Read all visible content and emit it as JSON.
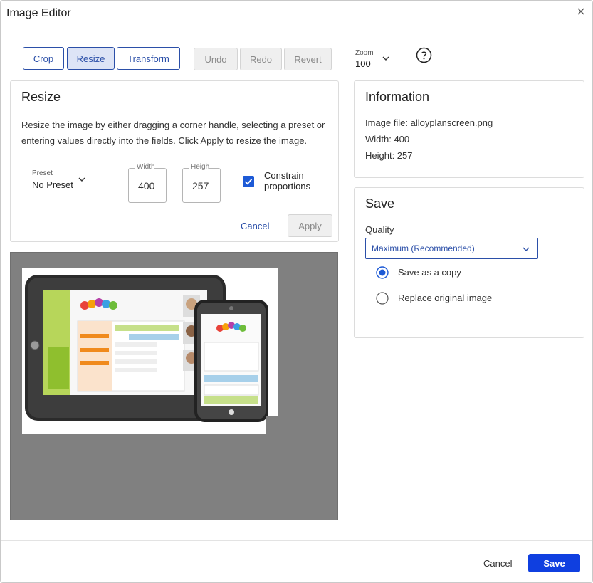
{
  "dialog": {
    "title": "Image Editor",
    "close_icon": "close-icon"
  },
  "toolbar": {
    "modes": [
      "Crop",
      "Resize",
      "Transform"
    ],
    "active_mode": "Resize",
    "history": [
      "Undo",
      "Redo",
      "Revert"
    ],
    "zoom_label": "Zoom",
    "zoom_value": "100",
    "help_icon": "help-circle-icon"
  },
  "resize": {
    "title": "Resize",
    "description": "Resize the image by either dragging a corner handle, selecting a preset or entering values directly into the fields. Click Apply to resize the image.",
    "preset_label": "Preset",
    "preset_value": "No Preset",
    "width_label": "Width",
    "width_value": "400",
    "height_label": "Height",
    "height_value": "257",
    "constrain_label_1": "Constrain",
    "constrain_label_2": "proportions",
    "constrain_checked": true,
    "cancel_label": "Cancel",
    "apply_label": "Apply"
  },
  "information": {
    "title": "Information",
    "file_line": "Image file: alloyplanscreen.png",
    "width_line": "Width: 400",
    "height_line": "Height: 257"
  },
  "save_panel": {
    "title": "Save",
    "quality_label": "Quality",
    "quality_value": "Maximum (Recommended)",
    "options": [
      "Save as a copy",
      "Replace original image"
    ],
    "selected_option": "Save as a copy"
  },
  "footer": {
    "cancel_label": "Cancel",
    "save_label": "Save"
  },
  "colors": {
    "accent": "#2b4fa8",
    "primary": "#0f3fe0",
    "canvas_bg": "#808080"
  }
}
